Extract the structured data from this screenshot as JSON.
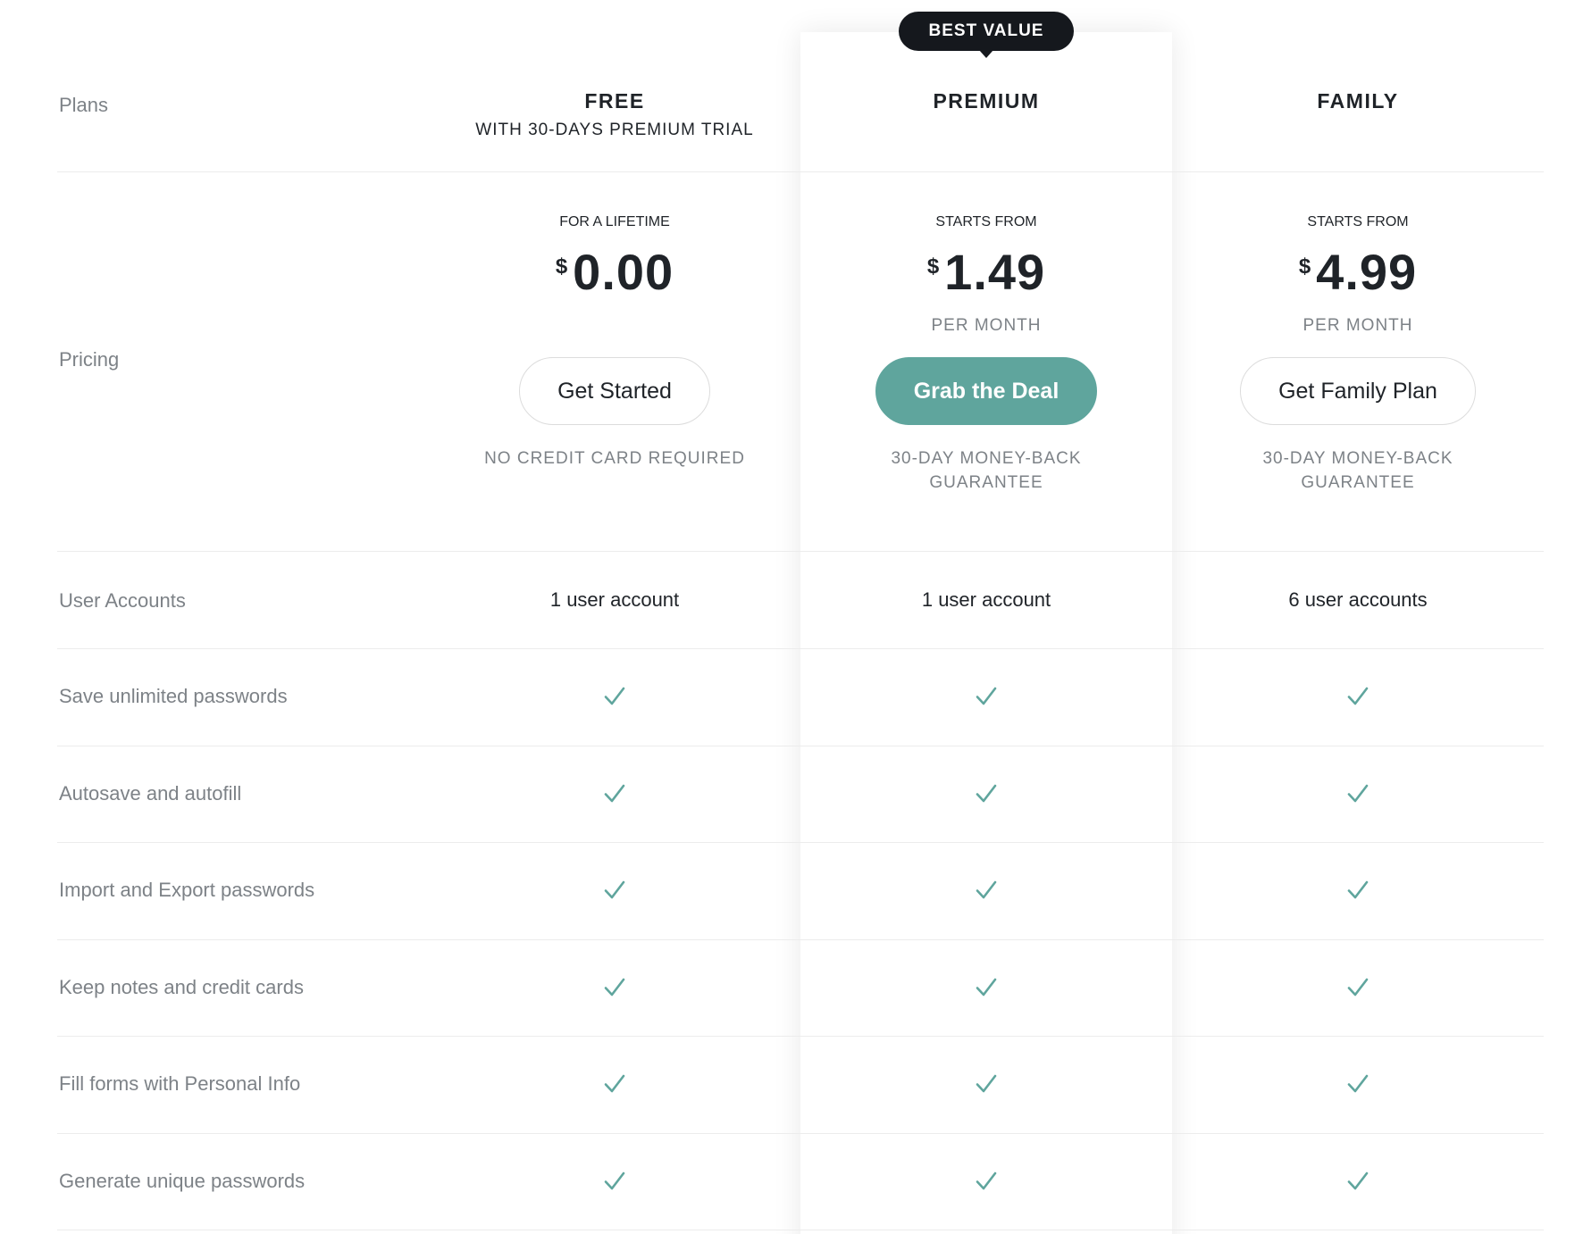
{
  "badge": "BEST VALUE",
  "rows": {
    "plans": "Plans",
    "pricing": "Pricing",
    "user_accounts": "User Accounts"
  },
  "plans": [
    {
      "name": "FREE",
      "subtitle": "WITH 30-DAYS PREMIUM TRIAL",
      "price_caption": "FOR A LIFETIME",
      "currency": "$",
      "price": "0.00",
      "per": "",
      "button": "Get Started",
      "note": "NO CREDIT CARD REQUIRED",
      "accounts": "1 user account"
    },
    {
      "name": "PREMIUM",
      "subtitle": "",
      "price_caption": "STARTS FROM",
      "currency": "$",
      "price": "1.49",
      "per": "PER MONTH",
      "button": "Grab the Deal",
      "note": "30-DAY MONEY-BACK GUARANTEE",
      "accounts": "1 user account"
    },
    {
      "name": "FAMILY",
      "subtitle": "",
      "price_caption": "STARTS FROM",
      "currency": "$",
      "price": "4.99",
      "per": "PER MONTH",
      "button": "Get Family Plan",
      "note": "30-DAY MONEY-BACK GUARANTEE",
      "accounts": "6 user accounts"
    }
  ],
  "features": [
    "Save unlimited passwords",
    "Autosave and autofill",
    "Import and Export passwords",
    "Keep notes and credit cards",
    "Fill forms with Personal Info",
    "Generate unique passwords"
  ],
  "colors": {
    "accent": "#5fa59d",
    "badge_bg": "#15181d",
    "label_text": "#7d8287",
    "divider": "#ececec"
  },
  "icons": {
    "feature_check": "check-icon"
  }
}
